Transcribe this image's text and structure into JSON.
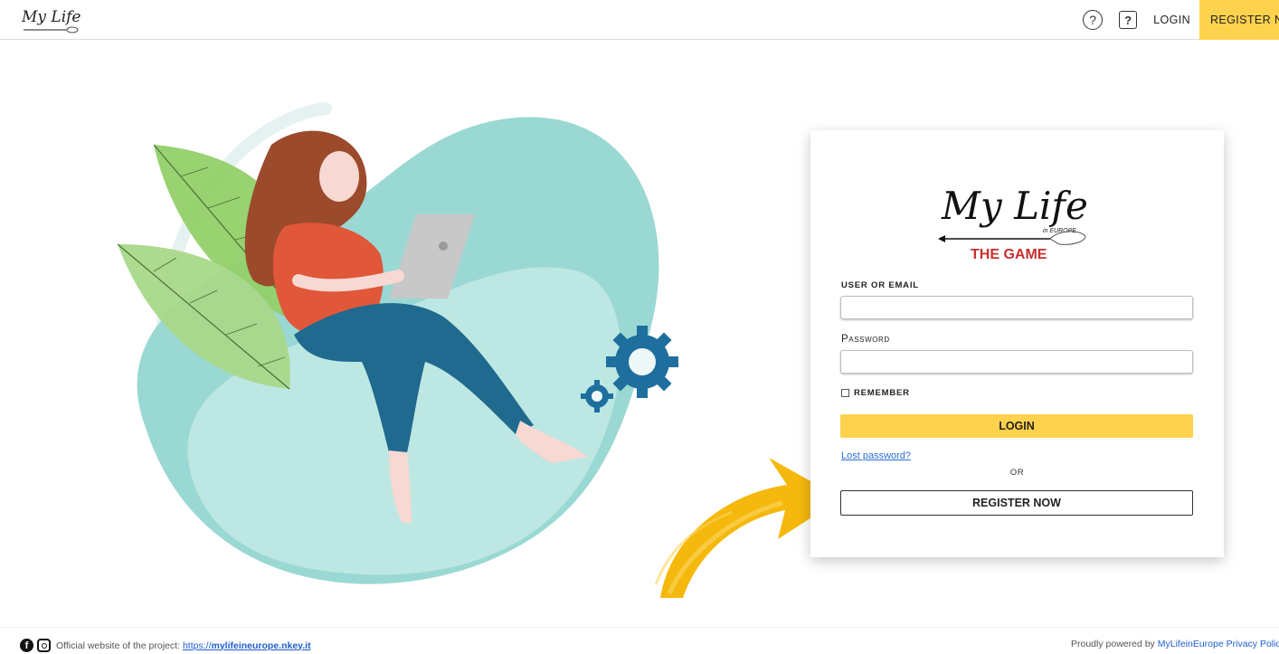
{
  "header": {
    "logo_text": "My Life",
    "help_icon": "question-circle-icon",
    "faq_icon": "question-square-icon",
    "login_label": "LOGIN",
    "register_label": "REGISTER NOW"
  },
  "login_card": {
    "logo_main": "My Life",
    "logo_sub": "in EUROPE",
    "logo_game": "THE GAME",
    "user_label": "USER OR EMAIL",
    "user_value": "",
    "password_label": "Password",
    "password_value": "",
    "remember_label": "REMEMBER",
    "login_button": "LOGIN",
    "lost_password": "Lost password?",
    "or_text": "OR",
    "register_button": "REGISTER NOW"
  },
  "footer": {
    "facebook_icon": "facebook-icon",
    "instagram_icon": "instagram-icon",
    "official_text": "Official website of the project:",
    "official_link_prefix": "https://",
    "official_link_bold": "mylifeineurope.nkey.it",
    "powered_text": "Proudly powered by",
    "powered_link": "MyLifeinEurope",
    "privacy_link": "Privacy Policy"
  },
  "colors": {
    "accent_yellow": "#ffd24d",
    "link_blue": "#2a6fd6",
    "blob_teal": "#8fd3cf"
  }
}
